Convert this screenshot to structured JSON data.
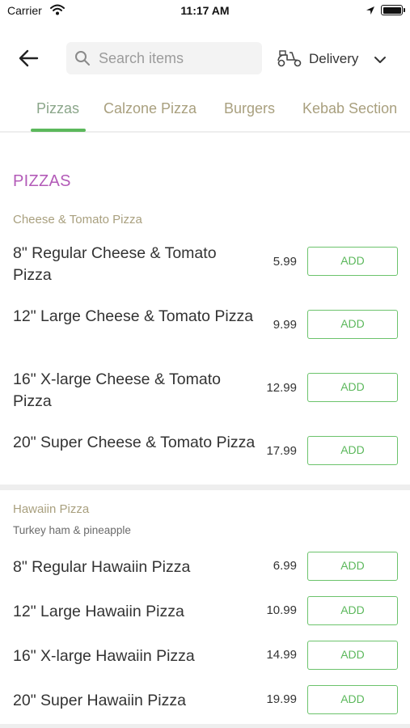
{
  "status_bar": {
    "carrier": "Carrier",
    "time": "11:17 AM"
  },
  "header": {
    "search_placeholder": "Search items",
    "search_value": "",
    "delivery_label": "Delivery",
    "icons": [
      "back-arrow-icon",
      "search-icon",
      "scooter-icon",
      "chevron-down-icon"
    ]
  },
  "tabs": [
    {
      "label": "Pizzas",
      "active": true
    },
    {
      "label": "Calzone Pizza",
      "active": false
    },
    {
      "label": "Burgers",
      "active": false
    },
    {
      "label": "Kebab Section",
      "active": false
    }
  ],
  "colors": {
    "accent_green": "#5cb85c",
    "section_title": "#b35bb8",
    "category_title": "#a9a07f"
  },
  "menu": {
    "section_title": "PIZZAS",
    "categories": [
      {
        "title": "Cheese & Tomato Pizza",
        "description": "",
        "items": [
          {
            "name": "8\" Regular Cheese & Tomato Pizza",
            "price": "5.99",
            "button": "ADD"
          },
          {
            "name": "12\" Large Cheese & Tomato Pizza",
            "price": "9.99",
            "button": "ADD"
          },
          {
            "name": "16\" X-large Cheese & Tomato Pizza",
            "price": "12.99",
            "button": "ADD"
          },
          {
            "name": "20\" Super Cheese & Tomato Pizza",
            "price": "17.99",
            "button": "ADD"
          }
        ]
      },
      {
        "title": "Hawaiin Pizza",
        "description": "Turkey ham & pineapple",
        "items": [
          {
            "name": "8\" Regular Hawaiin Pizza",
            "price": "6.99",
            "button": "ADD"
          },
          {
            "name": "12\" Large Hawaiin Pizza",
            "price": "10.99",
            "button": "ADD"
          },
          {
            "name": "16\" X-large Hawaiin Pizza",
            "price": "14.99",
            "button": "ADD"
          },
          {
            "name": "20\" Super Hawaiin Pizza",
            "price": "19.99",
            "button": "ADD"
          }
        ]
      }
    ]
  }
}
